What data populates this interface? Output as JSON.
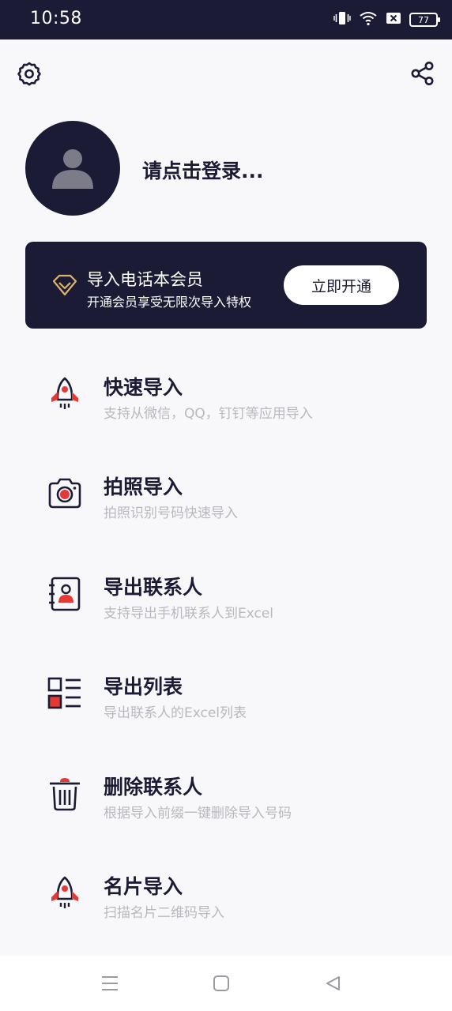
{
  "status_bar": {
    "time": "10:58",
    "battery": "77",
    "icons": [
      "vibrate-icon",
      "wifi-icon",
      "sim-x-icon",
      "battery-icon"
    ]
  },
  "header": {
    "left_icon": "settings-icon",
    "right_icon": "share-icon"
  },
  "profile": {
    "login_text": "请点击登录..."
  },
  "vip": {
    "icon": "diamond-icon",
    "title": "导入电话本会员",
    "subtitle": "开通会员享受无限次导入特权",
    "button_label": "立即开通"
  },
  "menu": [
    {
      "icon": "rocket-icon",
      "title": "快速导入",
      "desc": "支持从微信，QQ，钉钉等应用导入"
    },
    {
      "icon": "camera-icon",
      "title": "拍照导入",
      "desc": "拍照识别号码快速导入"
    },
    {
      "icon": "contact-book-icon",
      "title": "导出联系人",
      "desc": "支持导出手机联系人到Excel"
    },
    {
      "icon": "list-icon",
      "title": "导出列表",
      "desc": "导出联系人的Excel列表"
    },
    {
      "icon": "trash-icon",
      "title": "删除联系人",
      "desc": "根据导入前缀一键删除导入号码"
    },
    {
      "icon": "rocket-icon",
      "title": "名片导入",
      "desc": "扫描名片二维码导入"
    }
  ],
  "nav": [
    "menu-icon",
    "home-icon",
    "back-icon"
  ],
  "colors": {
    "primary": "#1c1b36",
    "accent": "#e53935",
    "gold": "#d9b46a",
    "muted": "#b8b8be"
  }
}
